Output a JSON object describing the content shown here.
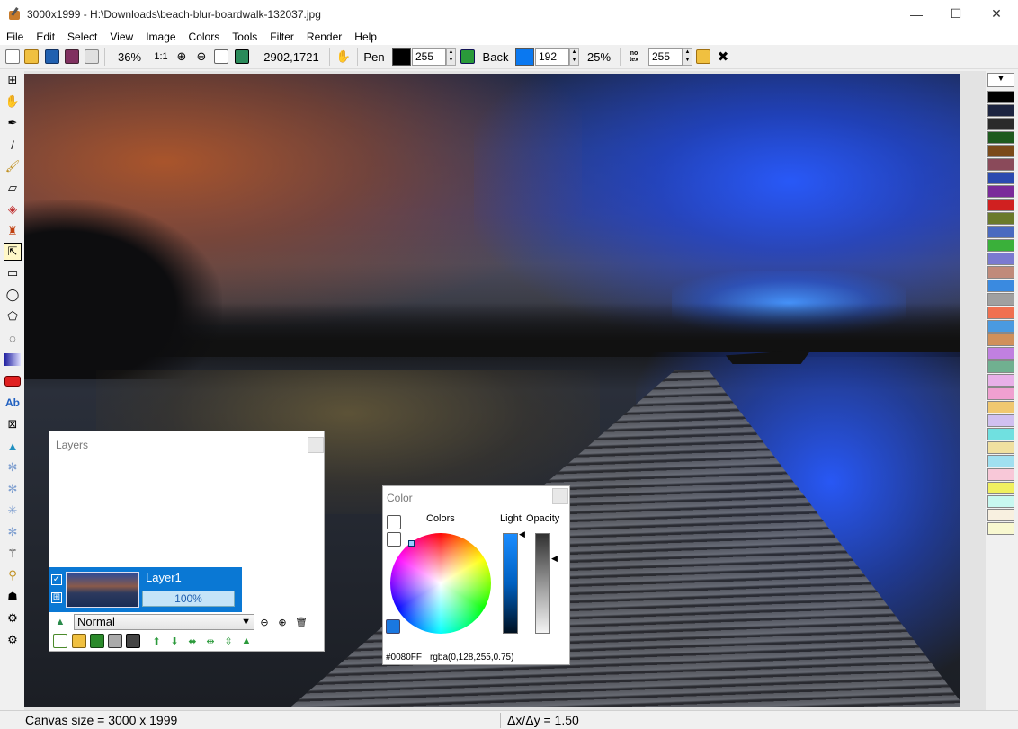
{
  "window": {
    "title": "3000x1999 - H:\\Downloads\\beach-blur-boardwalk-132037.jpg",
    "controls": [
      "—",
      "☐",
      "✕"
    ]
  },
  "menu": [
    "File",
    "Edit",
    "Select",
    "View",
    "Image",
    "Colors",
    "Tools",
    "Filter",
    "Render",
    "Help"
  ],
  "toolbar": {
    "zoom": "36%",
    "zoom_actual": "1:1",
    "coordinates": "2902,1721",
    "pen_label": "Pen",
    "pen_color": "#000000",
    "pen_alpha": "255",
    "back_label": "Back",
    "back_color": "#0a78f0",
    "back_alpha": "192",
    "back_percent": "25%",
    "tex_label": "no tex",
    "tex_alpha": "255"
  },
  "layers_panel": {
    "title": "Layers",
    "layer_name": "Layer1",
    "layer_opacity": "100%",
    "blend_mode": "Normal"
  },
  "color_panel": {
    "title": "Color",
    "colors_label": "Colors",
    "light_label": "Light",
    "opacity_label": "Opacity",
    "hex": "#0080FF",
    "rgba": "rgba(0,128,255,0.75)"
  },
  "palette": [
    "#000000",
    "#1c2440",
    "#2a2a2a",
    "#1e5a1e",
    "#7a4a1a",
    "#8a4a5a",
    "#2a4ab0",
    "#7a2a9a",
    "#d02020",
    "#6a7a2a",
    "#4a6ac0",
    "#3ab03a",
    "#7a7ad0",
    "#c08a7a",
    "#3a8ae0",
    "#a0a0a0",
    "#f07050",
    "#4a9ae0",
    "#d0905a",
    "#c080e0",
    "#70b090",
    "#e8b0e8",
    "#f0a0d0",
    "#f0c870",
    "#d0c0f0",
    "#70e0e0",
    "#f0e0a0",
    "#a0e0f0",
    "#f8c8d8",
    "#f0f060",
    "#c8f8f0",
    "#f8f0e0",
    "#f8f8d0"
  ],
  "status": {
    "canvas_size": "Canvas size = 3000 x 1999",
    "delta": "Δx/Δy = 1.50"
  }
}
